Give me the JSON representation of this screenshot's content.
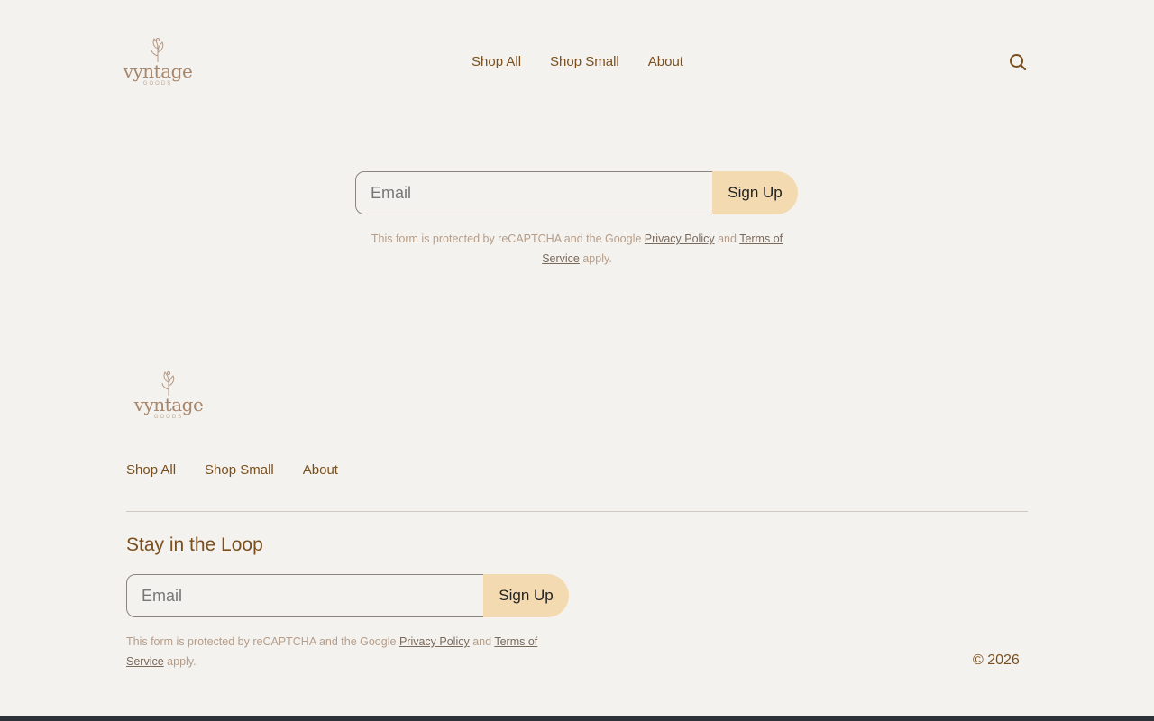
{
  "brand": {
    "name": "vyntage",
    "sub": "GOODS",
    "color": "#a8866b"
  },
  "header": {
    "nav": [
      {
        "label": "Shop All"
      },
      {
        "label": "Shop Small"
      },
      {
        "label": "About"
      }
    ],
    "search_icon": "search-icon"
  },
  "hero_signup": {
    "email_placeholder": "Email",
    "button_label": "Sign Up",
    "recaptcha": {
      "prefix": "This form is protected by reCAPTCHA and the Google",
      "privacy": "Privacy Policy",
      "and": "and",
      "terms": "Terms of Service",
      "suffix": "apply."
    }
  },
  "footer": {
    "nav": [
      {
        "label": "Shop All"
      },
      {
        "label": "Shop Small"
      },
      {
        "label": "About"
      }
    ],
    "loop_title": "Stay in the Loop",
    "signup": {
      "email_placeholder": "Email",
      "button_label": "Sign Up",
      "recaptcha": {
        "prefix": "This form is protected by reCAPTCHA and the Google",
        "privacy": "Privacy Policy",
        "and": "and",
        "terms": "Terms of Service",
        "suffix": "apply."
      }
    },
    "copyright": "© 2026"
  },
  "colors": {
    "background": "#f4f2ee",
    "text": "#7a4f1e",
    "button": "#f3dab0",
    "bottom_bar": "#2d3138"
  }
}
